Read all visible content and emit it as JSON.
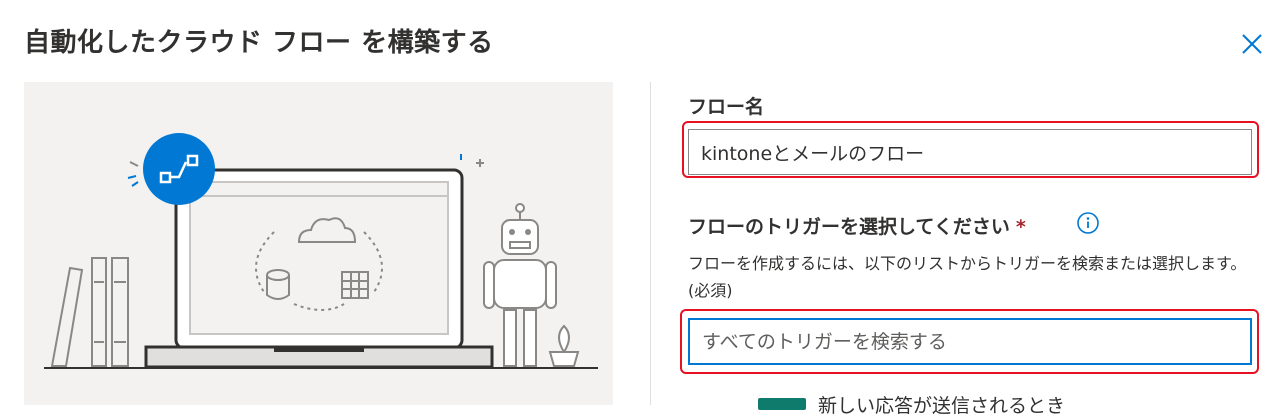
{
  "dialog": {
    "title": "自動化したクラウド フロー を構築する",
    "close_icon": "close-icon"
  },
  "flow_name": {
    "label": "フロー名",
    "value": "kintoneとメールのフロー"
  },
  "trigger": {
    "label": "フローのトリガーを選択してください",
    "required_mark": "*",
    "info_icon": "info-icon",
    "description": "フローを作成するには、以下のリストからトリガーを検索または選択します。(必須)",
    "search_placeholder": "すべてのトリガーを検索する"
  },
  "trigger_list": {
    "items": [
      {
        "label": "新しい応答が送信されるとき",
        "icon": "forms-app-icon"
      }
    ]
  },
  "colors": {
    "accent": "#0078d4",
    "highlight": "#e81123",
    "illustration_bg": "#f3f2f1",
    "required": "#a4262c"
  }
}
